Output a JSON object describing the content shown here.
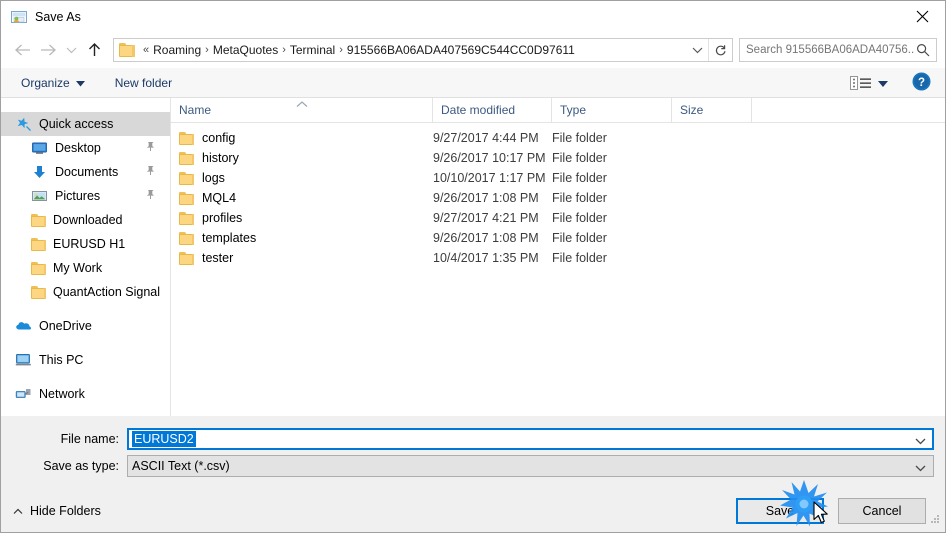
{
  "window": {
    "title": "Save As",
    "title_icon": "save-as-app-icon",
    "close_label": "✕"
  },
  "navigation": {
    "back_icon": "arrow-left-icon",
    "forward_icon": "arrow-right-icon",
    "recent_icon": "chevron-down-icon",
    "up_icon": "arrow-up-icon",
    "breadcrumbs": [
      "Roaming",
      "MetaQuotes",
      "Terminal",
      "915566BA06ADA407569C544CC0D97611"
    ],
    "overflow_marker": "«",
    "separator": "›",
    "dropdown_icon": "chevron-down-icon",
    "refresh_icon": "refresh-icon"
  },
  "search": {
    "placeholder": "Search 915566BA06ADA40756...",
    "value": "",
    "icon": "search-icon"
  },
  "toolbar": {
    "organize_label": "Organize",
    "organize_caret": "chevron-down-icon",
    "new_folder_label": "New folder",
    "view_icon": "view-options-icon",
    "view_caret": "chevron-down-icon",
    "help_icon": "help-icon",
    "help_label": "?"
  },
  "sidebar": {
    "items": [
      {
        "label": "Quick access",
        "icon": "star-pin-icon",
        "level": "root",
        "selected": true,
        "pinned": false
      },
      {
        "label": "Desktop",
        "icon": "desktop-icon",
        "level": "child",
        "selected": false,
        "pinned": true
      },
      {
        "label": "Documents",
        "icon": "documents-download-icon",
        "level": "child",
        "selected": false,
        "pinned": true
      },
      {
        "label": "Pictures",
        "icon": "pictures-icon",
        "level": "child",
        "selected": false,
        "pinned": true
      },
      {
        "label": "Downloaded",
        "icon": "folder-icon",
        "level": "child",
        "selected": false,
        "pinned": false
      },
      {
        "label": "EURUSD H1",
        "icon": "folder-icon",
        "level": "child",
        "selected": false,
        "pinned": false
      },
      {
        "label": "My Work",
        "icon": "folder-icon",
        "level": "child",
        "selected": false,
        "pinned": false
      },
      {
        "label": "QuantAction Signal",
        "icon": "folder-icon",
        "level": "child",
        "selected": false,
        "pinned": false
      },
      {
        "label": "OneDrive",
        "icon": "onedrive-cloud-icon",
        "level": "root",
        "selected": false,
        "pinned": false,
        "gap_before": true
      },
      {
        "label": "This PC",
        "icon": "this-pc-icon",
        "level": "root",
        "selected": false,
        "pinned": false,
        "gap_before": true
      },
      {
        "label": "Network",
        "icon": "network-icon",
        "level": "root",
        "selected": false,
        "pinned": false,
        "gap_before": true
      }
    ]
  },
  "file_list": {
    "columns": [
      "Name",
      "Date modified",
      "Type",
      "Size"
    ],
    "sort_column": "Name",
    "sort_direction": "ascending",
    "sort_icon": "caret-up-icon",
    "rows": [
      {
        "name": "config",
        "date": "9/27/2017 4:44 PM",
        "type": "File folder",
        "size": "",
        "icon": "folder-icon"
      },
      {
        "name": "history",
        "date": "9/26/2017 10:17 PM",
        "type": "File folder",
        "size": "",
        "icon": "folder-icon"
      },
      {
        "name": "logs",
        "date": "10/10/2017 1:17 PM",
        "type": "File folder",
        "size": "",
        "icon": "folder-icon"
      },
      {
        "name": "MQL4",
        "date": "9/26/2017 1:08 PM",
        "type": "File folder",
        "size": "",
        "icon": "folder-icon"
      },
      {
        "name": "profiles",
        "date": "9/27/2017 4:21 PM",
        "type": "File folder",
        "size": "",
        "icon": "folder-icon"
      },
      {
        "name": "templates",
        "date": "9/26/2017 1:08 PM",
        "type": "File folder",
        "size": "",
        "icon": "folder-icon"
      },
      {
        "name": "tester",
        "date": "10/4/2017 1:35 PM",
        "type": "File folder",
        "size": "",
        "icon": "folder-icon"
      }
    ]
  },
  "form": {
    "filename_label": "File name:",
    "filename_value": "EURUSD2",
    "filename_selected": true,
    "filetype_label": "Save as type:",
    "filetype_value": "ASCII Text (*.csv)",
    "dropdown_icon": "chevron-down-icon"
  },
  "footer": {
    "hide_folders_label": "Hide Folders",
    "hide_folders_icon": "chevron-up-icon",
    "save_label": "Save",
    "cancel_label": "Cancel",
    "resize_grip_icon": "resize-grip-icon"
  },
  "pointer": {
    "click_indicator": "click-burst-icon",
    "cursor_icon": "arrow-cursor-icon"
  },
  "colors": {
    "accent": "#0078d7",
    "folder": "#fcd681",
    "selection": "#d8d8d8",
    "header_text": "#3b5a82"
  }
}
